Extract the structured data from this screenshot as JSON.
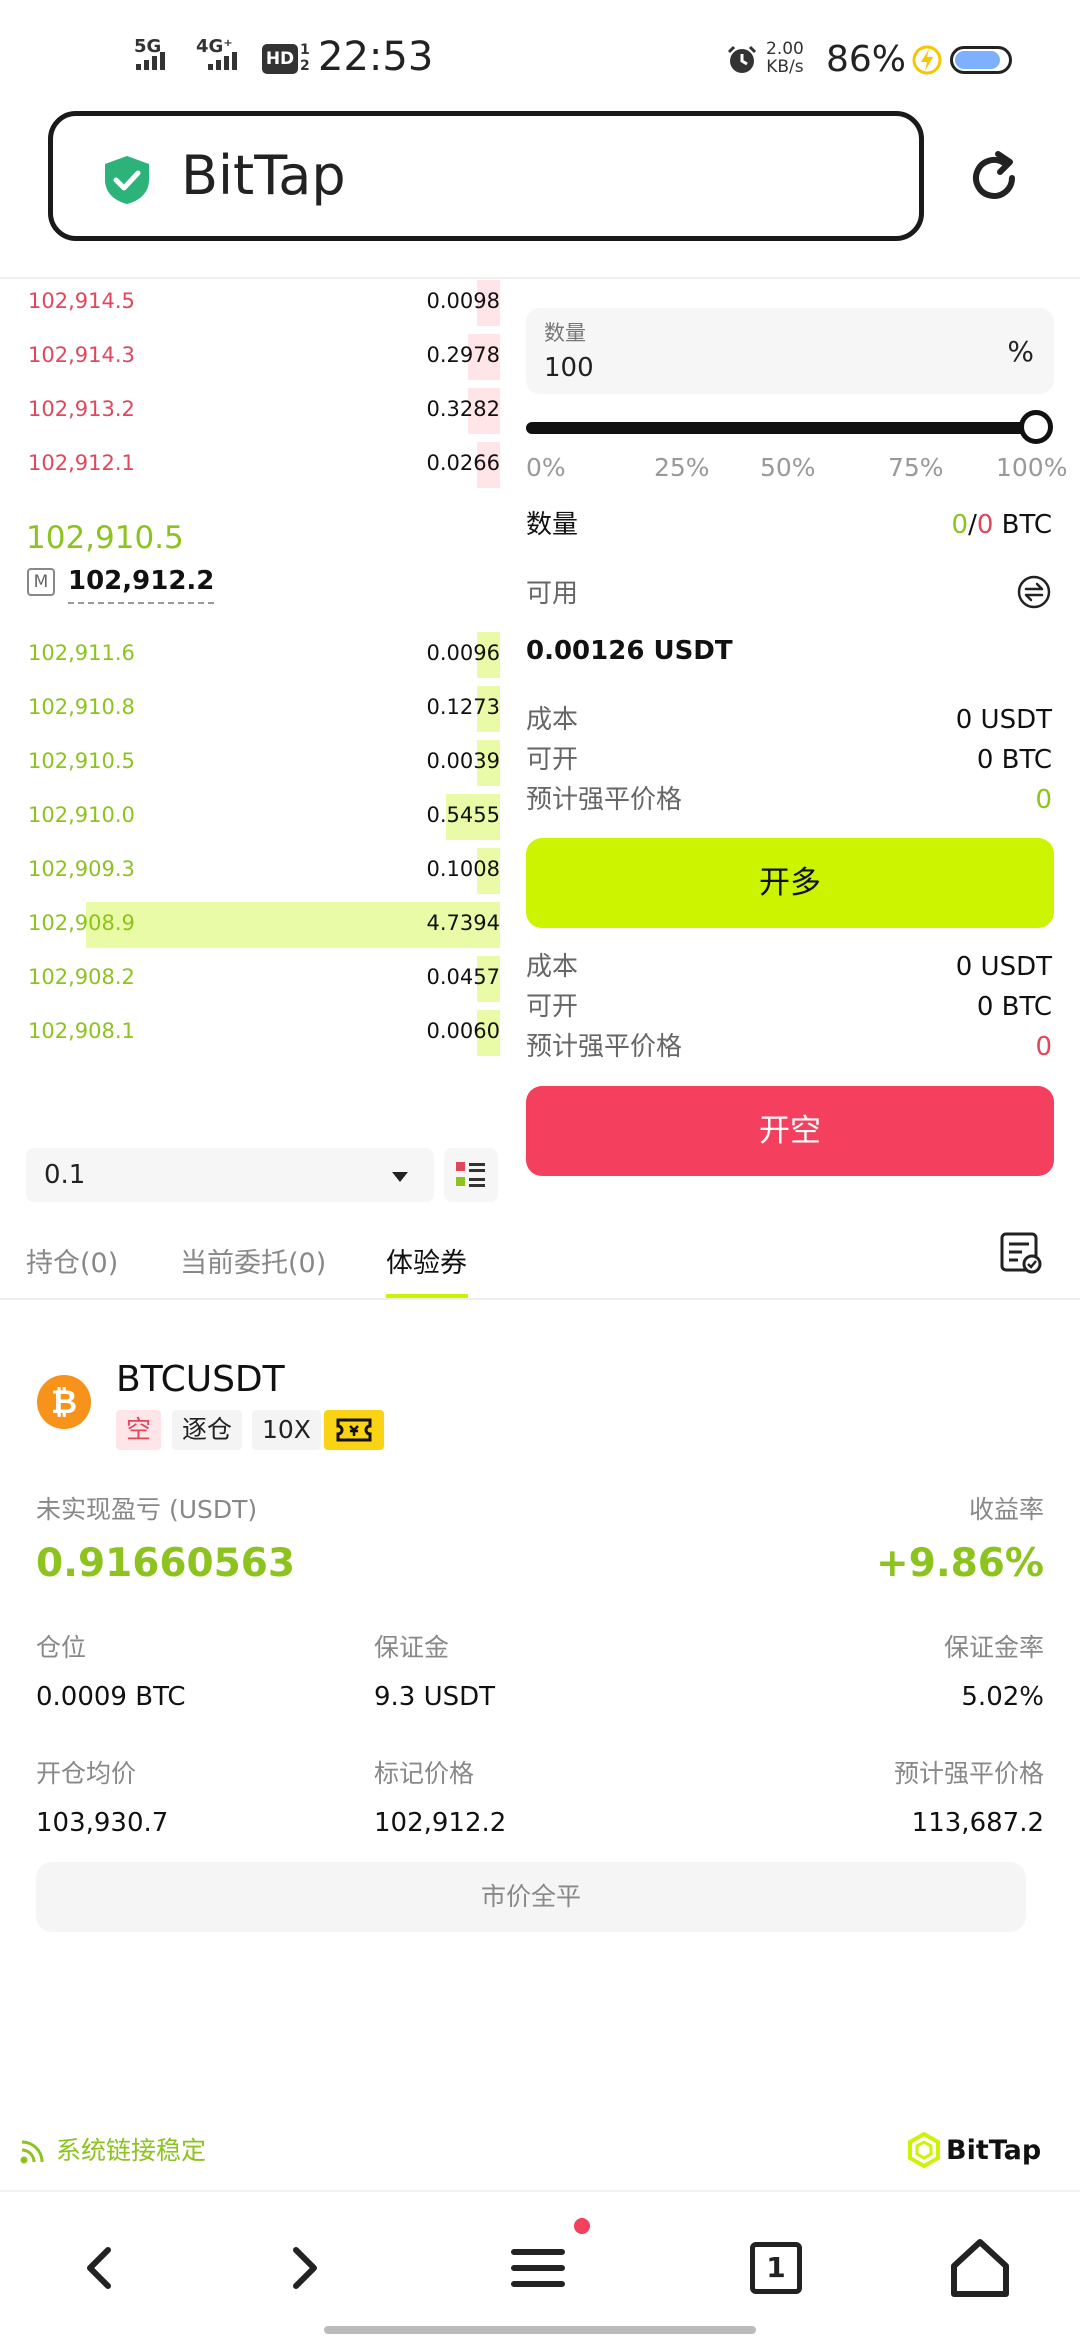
{
  "status_bar": {
    "net1": "5G",
    "net2": "4G⁺",
    "hd": "HD",
    "hd_sub1": "1",
    "hd_sub2": "2",
    "time": "22:53",
    "speed_value": "2.00",
    "speed_unit": "KB/s",
    "battery": "86%",
    "battery_level": 0.86
  },
  "browser": {
    "title": "BitTap",
    "secure_icon": "shield-check-icon",
    "reload_icon": "reload-icon"
  },
  "orderbook": {
    "asks": [
      {
        "price": "102,914.5",
        "qty": "0.0098",
        "depth": 0.05
      },
      {
        "price": "102,914.3",
        "qty": "0.2978",
        "depth": 0.07
      },
      {
        "price": "102,913.2",
        "qty": "0.3282",
        "depth": 0.07
      },
      {
        "price": "102,912.1",
        "qty": "0.0266",
        "depth": 0.05
      }
    ],
    "last_price": "102,910.5",
    "mark_label": "M",
    "mark_price": "102,912.2",
    "bids": [
      {
        "price": "102,911.6",
        "qty": "0.0096",
        "depth": 0.05
      },
      {
        "price": "102,910.8",
        "qty": "0.1273",
        "depth": 0.05
      },
      {
        "price": "102,910.5",
        "qty": "0.0039",
        "depth": 0.05
      },
      {
        "price": "102,910.0",
        "qty": "0.5455",
        "depth": 0.12
      },
      {
        "price": "102,909.3",
        "qty": "0.1008",
        "depth": 0.05
      },
      {
        "price": "102,908.9",
        "qty": "4.7394",
        "depth": 0.92
      },
      {
        "price": "102,908.2",
        "qty": "0.0457",
        "depth": 0.05
      },
      {
        "price": "102,908.1",
        "qty": "0.0060",
        "depth": 0.05
      }
    ],
    "precision": "0.1"
  },
  "order_form": {
    "qty_label": "数量",
    "qty_value": "100",
    "qty_unit": "%",
    "slider_value": 1.0,
    "ticks": [
      "0%",
      "25%",
      "50%",
      "75%",
      "100%"
    ],
    "amount_label": "数量",
    "amount_long": "0",
    "amount_sep": "/",
    "amount_short": "0",
    "amount_unit": "BTC",
    "available_label": "可用",
    "available_value": "0.00126 USDT",
    "long": {
      "cost_label": "成本",
      "cost_value": "0 USDT",
      "open_label": "可开",
      "open_value": "0 BTC",
      "liq_label": "预计强平价格",
      "liq_value": "0",
      "button": "开多"
    },
    "short": {
      "cost_label": "成本",
      "cost_value": "0 USDT",
      "open_label": "可开",
      "open_value": "0 BTC",
      "liq_label": "预计强平价格",
      "liq_value": "0",
      "button": "开空"
    }
  },
  "tabs": [
    {
      "label": "持仓(0)",
      "active": false
    },
    {
      "label": "当前委托(0)",
      "active": false
    },
    {
      "label": "体验券",
      "active": true
    }
  ],
  "position": {
    "symbol": "BTCUSDT",
    "tags": [
      "空",
      "逐仓",
      "10X"
    ],
    "pnl_label": "未实现盈亏 (USDT)",
    "pnl_value": "0.91660563",
    "roe_label": "收益率",
    "roe_value": "+9.86%",
    "size_label": "仓位",
    "size_value": "0.0009 BTC",
    "margin_label": "保证金",
    "margin_value": "9.3 USDT",
    "margin_ratio_label": "保证金率",
    "margin_ratio_value": "5.02%",
    "entry_label": "开仓均价",
    "entry_value": "103,930.7",
    "mark_label": "标记价格",
    "mark_value": "102,912.2",
    "liq_label": "预计强平价格",
    "liq_value": "113,687.2",
    "close_all": "市价全平"
  },
  "footer": {
    "connection": "系统链接稳定",
    "brand": "BitTap"
  },
  "nav": {
    "tab_count": "1"
  },
  "colors": {
    "green": "#8cc31e",
    "red": "#e0475c",
    "accent_long": "#ccf300",
    "accent_short": "#f43f5e"
  }
}
